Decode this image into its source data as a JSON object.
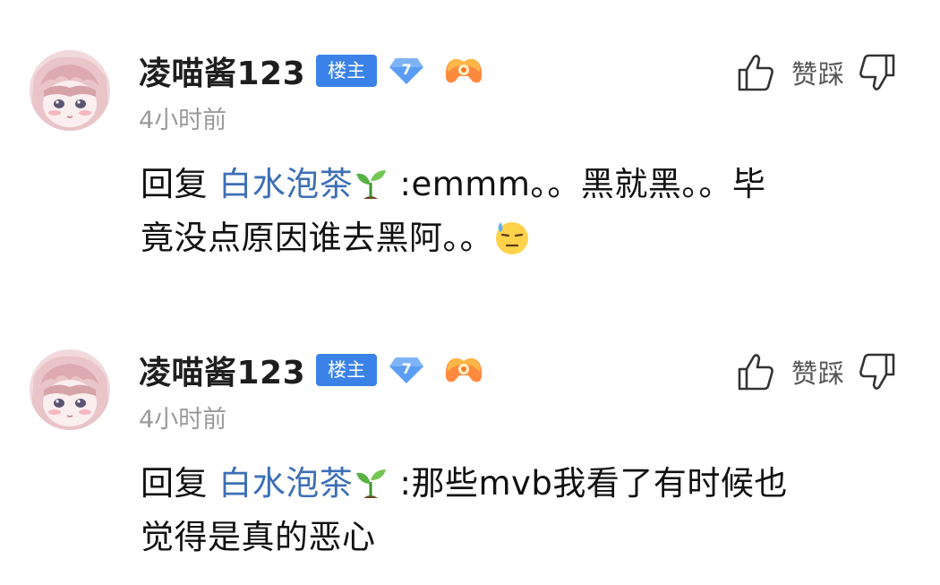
{
  "comments": [
    {
      "username": "凌喵酱123",
      "owner_badge": "楼主",
      "level": "7",
      "time": "4小时前",
      "vote_label": "赞踩",
      "reply_prefix": "回复",
      "mention": "白水泡茶",
      "text_line1": " :emmm。。黑就黑。。毕",
      "text_line2": "竟没点原因谁去黑阿。。"
    },
    {
      "username": "凌喵酱123",
      "owner_badge": "楼主",
      "level": "7",
      "time": "4小时前",
      "vote_label": "赞踩",
      "reply_prefix": "回复",
      "mention": "白水泡茶",
      "text_line1": " :那些mvb我看了有时候也",
      "text_line2": "觉得是真的恶心"
    }
  ],
  "icons": {
    "avatar": "anime-girl-avatar",
    "level": "diamond-level-icon",
    "game": "game-controller-icon",
    "like": "thumbs-up-icon",
    "dislike": "thumbs-down-icon",
    "sprout": "sprout-emoji",
    "sweat": "sweat-face-emoji"
  },
  "colors": {
    "owner_badge": "#3b82e8",
    "mention": "#3c6fb6",
    "level_diamond": "#5b9df5",
    "timestamp": "#9a9a9a"
  }
}
